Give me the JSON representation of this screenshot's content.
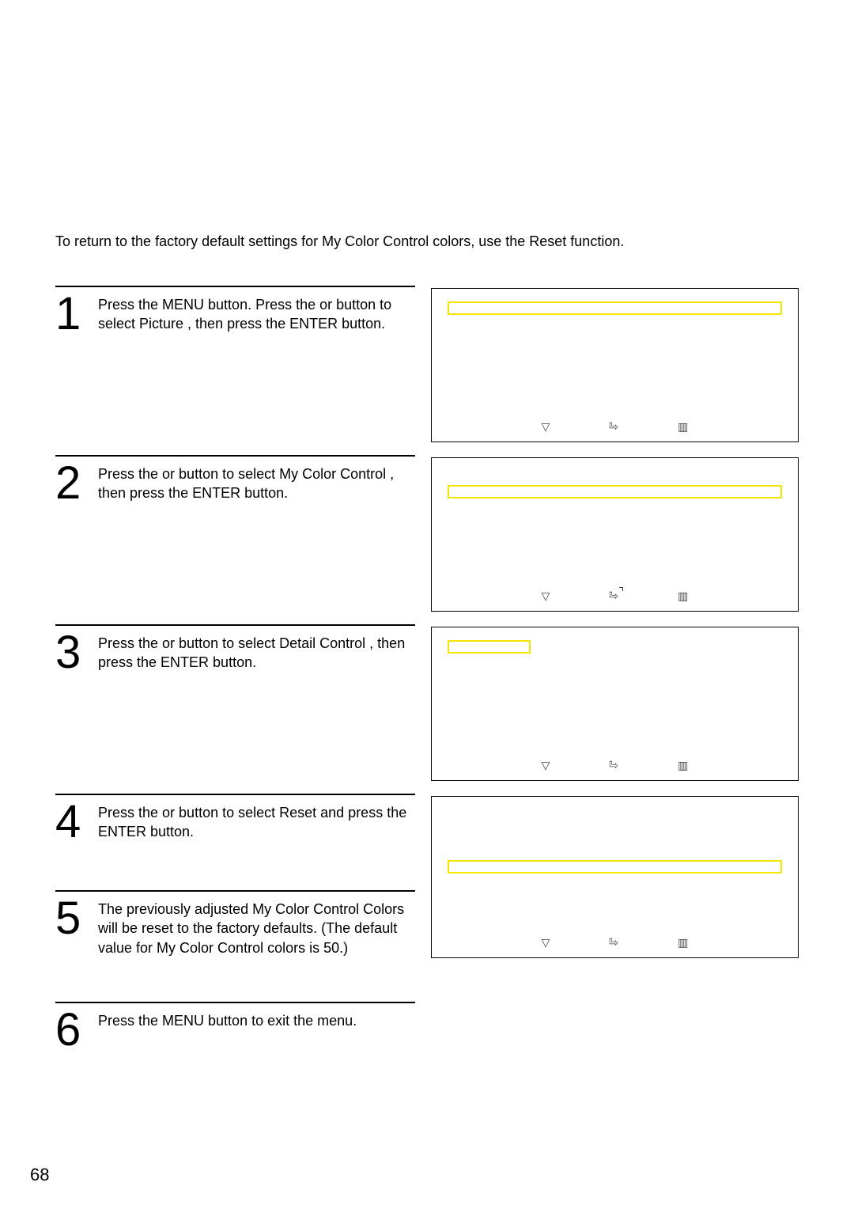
{
  "intro": "To return to the factory default settings for My Color Control colors, use the Reset function.",
  "steps": {
    "s1": {
      "num": "1",
      "text": "Press the MENU button. Press the  or     button to select  Picture , then press the ENTER button."
    },
    "s2": {
      "num": "2",
      "text": "Press the   or     button to select  My Color Control , then press the ENTER button."
    },
    "s3": {
      "num": "3",
      "text": "Press the   or     button to select  Detail Control , then press the ENTER button."
    },
    "s4": {
      "num": "4",
      "text": "Press the   or     button to select  Reset  and press the ENTER button."
    },
    "s5": {
      "num": "5",
      "text": "The previously adjusted My Color Control Colors will be reset to the factory defaults. (The default value for My Color Control colors is 50.)"
    },
    "s6": {
      "num": "6",
      "text": "Press the MENU button to exit the menu."
    }
  },
  "page_number": "68"
}
